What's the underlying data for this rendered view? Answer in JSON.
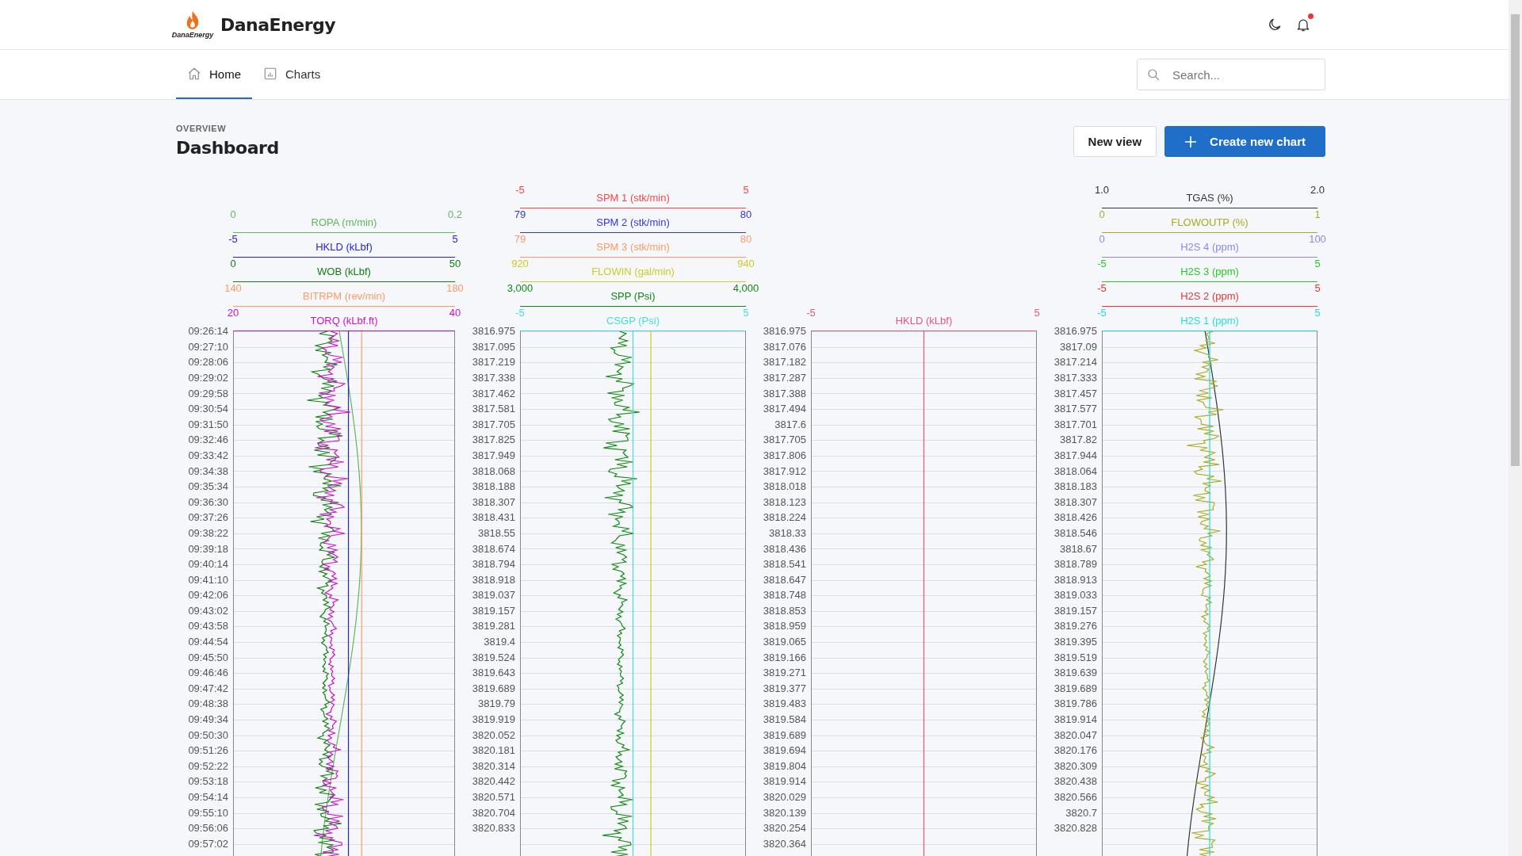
{
  "header": {
    "brand": "DanaEnergy",
    "logo_caption": "DanaEnergy",
    "notifications_unread": true
  },
  "nav": {
    "tabs": [
      {
        "label": "Home",
        "selected": true
      },
      {
        "label": "Charts",
        "selected": false
      }
    ],
    "search": {
      "placeholder": "Search..."
    }
  },
  "page": {
    "eyebrow": "OVERVIEW",
    "title": "Dashboard",
    "buttons": [
      {
        "label": "New view",
        "kind": "secondary"
      },
      {
        "label": "Create new chart",
        "kind": "primary"
      }
    ]
  },
  "tracks": [
    {
      "curves": [
        {
          "name": "ROPA (m/min)",
          "min": "0",
          "max": "0.2",
          "color": "#5cb85c",
          "kind": "drift"
        },
        {
          "name": "HKLD (kLbf)",
          "min": "-5",
          "max": "5",
          "color": "#2222ee",
          "kind": "flat"
        },
        {
          "name": "WOB (kLbf)",
          "min": "0",
          "max": "50",
          "color": "#108010",
          "kind": "noisy"
        },
        {
          "name": "BITRPM (rev/min)",
          "min": "140",
          "max": "180",
          "color": "#ff9966",
          "kind": "flat"
        },
        {
          "name": "TORQ (kLbf.ft)",
          "min": "20",
          "max": "40",
          "color": "#cc11cc",
          "kind": "noisy"
        }
      ],
      "index_labels": [
        "09:26:14",
        "09:27:10",
        "09:28:06",
        "09:29:02",
        "09:29:58",
        "09:30:54",
        "09:31:50",
        "09:32:46",
        "09:33:42",
        "09:34:38",
        "09:35:34",
        "09:36:30",
        "09:37:26",
        "09:38:22",
        "09:39:18",
        "09:40:14",
        "09:41:10",
        "09:42:06",
        "09:43:02",
        "09:43:58",
        "09:44:54",
        "09:45:50",
        "09:46:46",
        "09:47:42",
        "09:48:38",
        "09:49:34",
        "09:50:30",
        "09:51:26",
        "09:52:22",
        "09:53:18",
        "09:54:14",
        "09:55:10",
        "09:56:06",
        "09:57:02"
      ]
    },
    {
      "curves": [
        {
          "name": "SPM 1 (stk/min)",
          "min": "-5",
          "max": "5",
          "color": "#ff4444",
          "kind": "none"
        },
        {
          "name": "SPM 2 (stk/min)",
          "min": "79",
          "max": "80",
          "color": "#3333ee",
          "kind": "none"
        },
        {
          "name": "SPM 3 (stk/min)",
          "min": "79",
          "max": "80",
          "color": "#ff9966",
          "kind": "none"
        },
        {
          "name": "FLOWIN (gal/min)",
          "min": "920",
          "max": "940",
          "color": "#cccc22",
          "kind": "flat"
        },
        {
          "name": "SPP (Psi)",
          "min": "3,000",
          "max": "4,000",
          "color": "#118811",
          "kind": "noisy"
        },
        {
          "name": "CSGP (Psi)",
          "min": "-5",
          "max": "5",
          "color": "#44dddd",
          "kind": "flat"
        }
      ],
      "index_labels": [
        "3816.975",
        "3817.095",
        "3817.219",
        "3817.338",
        "3817.462",
        "3817.581",
        "3817.705",
        "3817.825",
        "3817.949",
        "3818.068",
        "3818.188",
        "3818.307",
        "3818.431",
        "3818.55",
        "3818.674",
        "3818.794",
        "3818.918",
        "3819.037",
        "3819.157",
        "3819.281",
        "3819.4",
        "3819.524",
        "3819.643",
        "3819.689",
        "3819.79",
        "3819.919",
        "3820.052",
        "3820.181",
        "3820.314",
        "3820.442",
        "3820.571",
        "3820.704",
        "3820.833"
      ]
    },
    {
      "curves": [
        {
          "name": "HKLD (kLbf)",
          "min": "-5",
          "max": "5",
          "color": "#ee5577",
          "kind": "flat"
        }
      ],
      "index_labels": [
        "3816.975",
        "3817.076",
        "3817.182",
        "3817.287",
        "3817.388",
        "3817.494",
        "3817.6",
        "3817.705",
        "3817.806",
        "3817.912",
        "3818.018",
        "3818.123",
        "3818.224",
        "3818.33",
        "3818.436",
        "3818.541",
        "3818.647",
        "3818.748",
        "3818.853",
        "3818.959",
        "3819.065",
        "3819.166",
        "3819.271",
        "3819.377",
        "3819.483",
        "3819.584",
        "3819.689",
        "3819.694",
        "3819.804",
        "3819.914",
        "3820.029",
        "3820.139",
        "3820.254",
        "3820.364"
      ]
    },
    {
      "curves": [
        {
          "name": "TGAS (%)",
          "min": "1.0",
          "max": "2.0",
          "color": "#333333",
          "kind": "drift"
        },
        {
          "name": "FLOWOUTP (%)",
          "min": "0",
          "max": "1",
          "color": "#aaaa22",
          "kind": "noisy"
        },
        {
          "name": "H2S 4 (ppm)",
          "min": "0",
          "max": "100",
          "color": "#8888ee",
          "kind": "none"
        },
        {
          "name": "H2S 3 (ppm)",
          "min": "-5",
          "max": "5",
          "color": "#22cc22",
          "kind": "none"
        },
        {
          "name": "H2S 2 (ppm)",
          "min": "-5",
          "max": "5",
          "color": "#ee3333",
          "kind": "none"
        },
        {
          "name": "H2S 1 (ppm)",
          "min": "-5",
          "max": "5",
          "color": "#22dddd",
          "kind": "flat"
        }
      ],
      "index_labels": [
        "3816.975",
        "3817.09",
        "3817.214",
        "3817.333",
        "3817.457",
        "3817.577",
        "3817.701",
        "3817.82",
        "3817.944",
        "3818.064",
        "3818.183",
        "3818.307",
        "3818.426",
        "3818.546",
        "3818.67",
        "3818.789",
        "3818.913",
        "3819.033",
        "3819.157",
        "3819.276",
        "3819.395",
        "3819.519",
        "3819.639",
        "3819.689",
        "3819.786",
        "3819.914",
        "3820.047",
        "3820.176",
        "3820.309",
        "3820.438",
        "3820.566",
        "3820.7",
        "3820.828"
      ]
    }
  ]
}
